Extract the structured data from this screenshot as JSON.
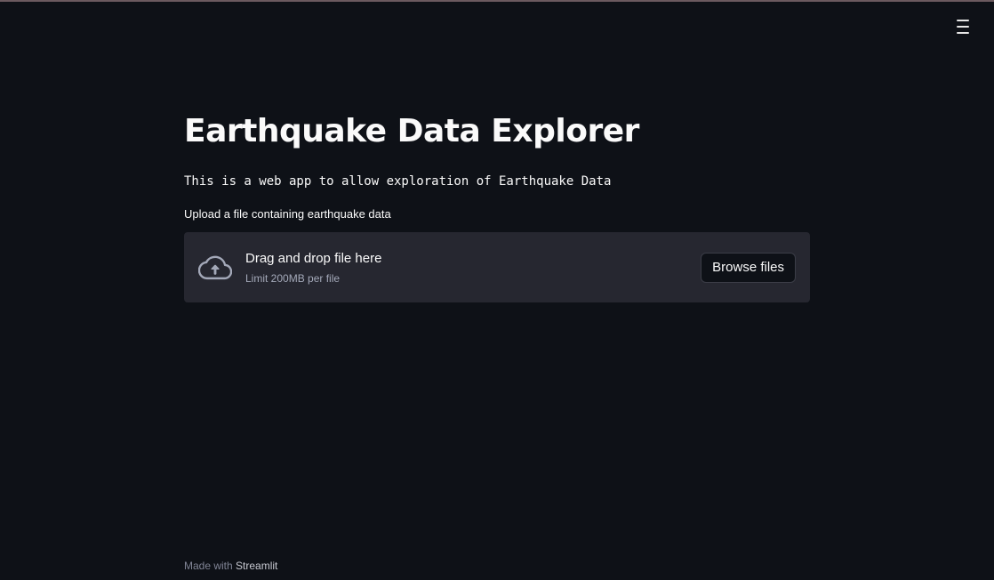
{
  "app": {
    "title": "Earthquake Data Explorer",
    "description": "This is a web app to allow exploration of Earthquake Data"
  },
  "menu": {
    "icon": "hamburger-menu-icon"
  },
  "uploader": {
    "label": "Upload a file containing earthquake data",
    "dropzone_title": "Drag and drop file here",
    "limit_text": "Limit 200MB per file",
    "browse_label": "Browse files",
    "icon": "cloud-upload-icon"
  },
  "footer": {
    "prefix": "Made with ",
    "brand": "Streamlit"
  },
  "colors": {
    "background": "#0e1117",
    "panel": "#262730",
    "text": "#fafafa",
    "muted": "#808495"
  }
}
